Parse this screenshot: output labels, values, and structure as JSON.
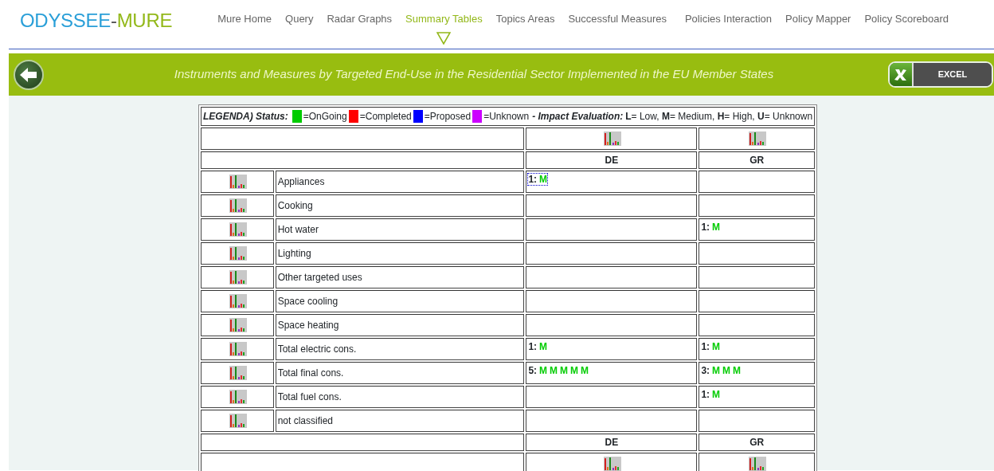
{
  "logo": {
    "part1": "ODYSSEE",
    "separator": "-",
    "part2": "MURE"
  },
  "nav": [
    {
      "label": "Mure Home",
      "selected": false
    },
    {
      "label": "Query",
      "selected": false
    },
    {
      "label": "Radar Graphs",
      "selected": false
    },
    {
      "label": "Summary Tables",
      "selected": true
    },
    {
      "label": "Topics Areas",
      "selected": false
    },
    {
      "label": "Successful Measures",
      "selected": false
    },
    {
      "label": "Policies Interaction",
      "selected": false
    },
    {
      "label": "Policy Mapper",
      "selected": false
    },
    {
      "label": "Policy Scoreboard",
      "selected": false
    }
  ],
  "banner": {
    "title": "Instruments and Measures by Targeted End-Use in the Residential Sector Implemented in the EU Member States",
    "excel_button": "EXCEL"
  },
  "legend": {
    "title": "LEGENDA) Status:",
    "statuses": [
      {
        "label": "=OnGoing",
        "color": "#00cc00"
      },
      {
        "label": "=Completed",
        "color": "#ff0000"
      },
      {
        "label": "=Proposed",
        "color": "#0000ff"
      },
      {
        "label": "=Unknown",
        "color": "#cc00ff"
      }
    ],
    "impact_title": "- Impact Evaluation:",
    "impact_text": "**L**= Low, **M**= Medium, **H**= High, **U**= Unknown"
  },
  "countries": [
    "DE",
    "GR"
  ],
  "footer_countries": [
    "DE",
    "GR"
  ],
  "rows": [
    {
      "label": "Appliances",
      "cells": [
        {
          "count": "1:",
          "focused": true,
          "measures": [
            {
              "grade": "M",
              "color": "#00cc00"
            }
          ]
        },
        null
      ]
    },
    {
      "label": "Cooking",
      "cells": [
        null,
        null
      ]
    },
    {
      "label": "Hot water",
      "cells": [
        null,
        {
          "count": "1:",
          "focused": false,
          "measures": [
            {
              "grade": "M",
              "color": "#00cc00"
            }
          ]
        }
      ]
    },
    {
      "label": "Lighting",
      "cells": [
        null,
        null
      ]
    },
    {
      "label": "Other targeted uses",
      "cells": [
        null,
        null
      ]
    },
    {
      "label": "Space cooling",
      "cells": [
        null,
        null
      ]
    },
    {
      "label": "Space heating",
      "cells": [
        null,
        null
      ]
    },
    {
      "label": "Total electric cons.",
      "cells": [
        {
          "count": "1:",
          "focused": false,
          "measures": [
            {
              "grade": "M",
              "color": "#00cc00"
            }
          ]
        },
        {
          "count": "1:",
          "focused": false,
          "measures": [
            {
              "grade": "M",
              "color": "#00cc00"
            }
          ]
        }
      ]
    },
    {
      "label": "Total final cons.",
      "cells": [
        {
          "count": "5:",
          "focused": false,
          "measures": [
            {
              "grade": "M",
              "color": "#00cc00"
            },
            {
              "grade": "M",
              "color": "#00cc00"
            },
            {
              "grade": "M",
              "color": "#00cc00"
            },
            {
              "grade": "M",
              "color": "#00cc00"
            },
            {
              "grade": "M",
              "color": "#00cc00"
            }
          ]
        },
        {
          "count": "3:",
          "focused": false,
          "measures": [
            {
              "grade": "M",
              "color": "#00cc00"
            },
            {
              "grade": "M",
              "color": "#00cc00"
            },
            {
              "grade": "M",
              "color": "#00cc00"
            }
          ]
        }
      ]
    },
    {
      "label": "Total fuel cons.",
      "cells": [
        null,
        {
          "count": "1:",
          "focused": false,
          "measures": [
            {
              "grade": "M",
              "color": "#00cc00"
            }
          ]
        }
      ]
    },
    {
      "label": "not classified",
      "cells": [
        null,
        null
      ]
    }
  ]
}
